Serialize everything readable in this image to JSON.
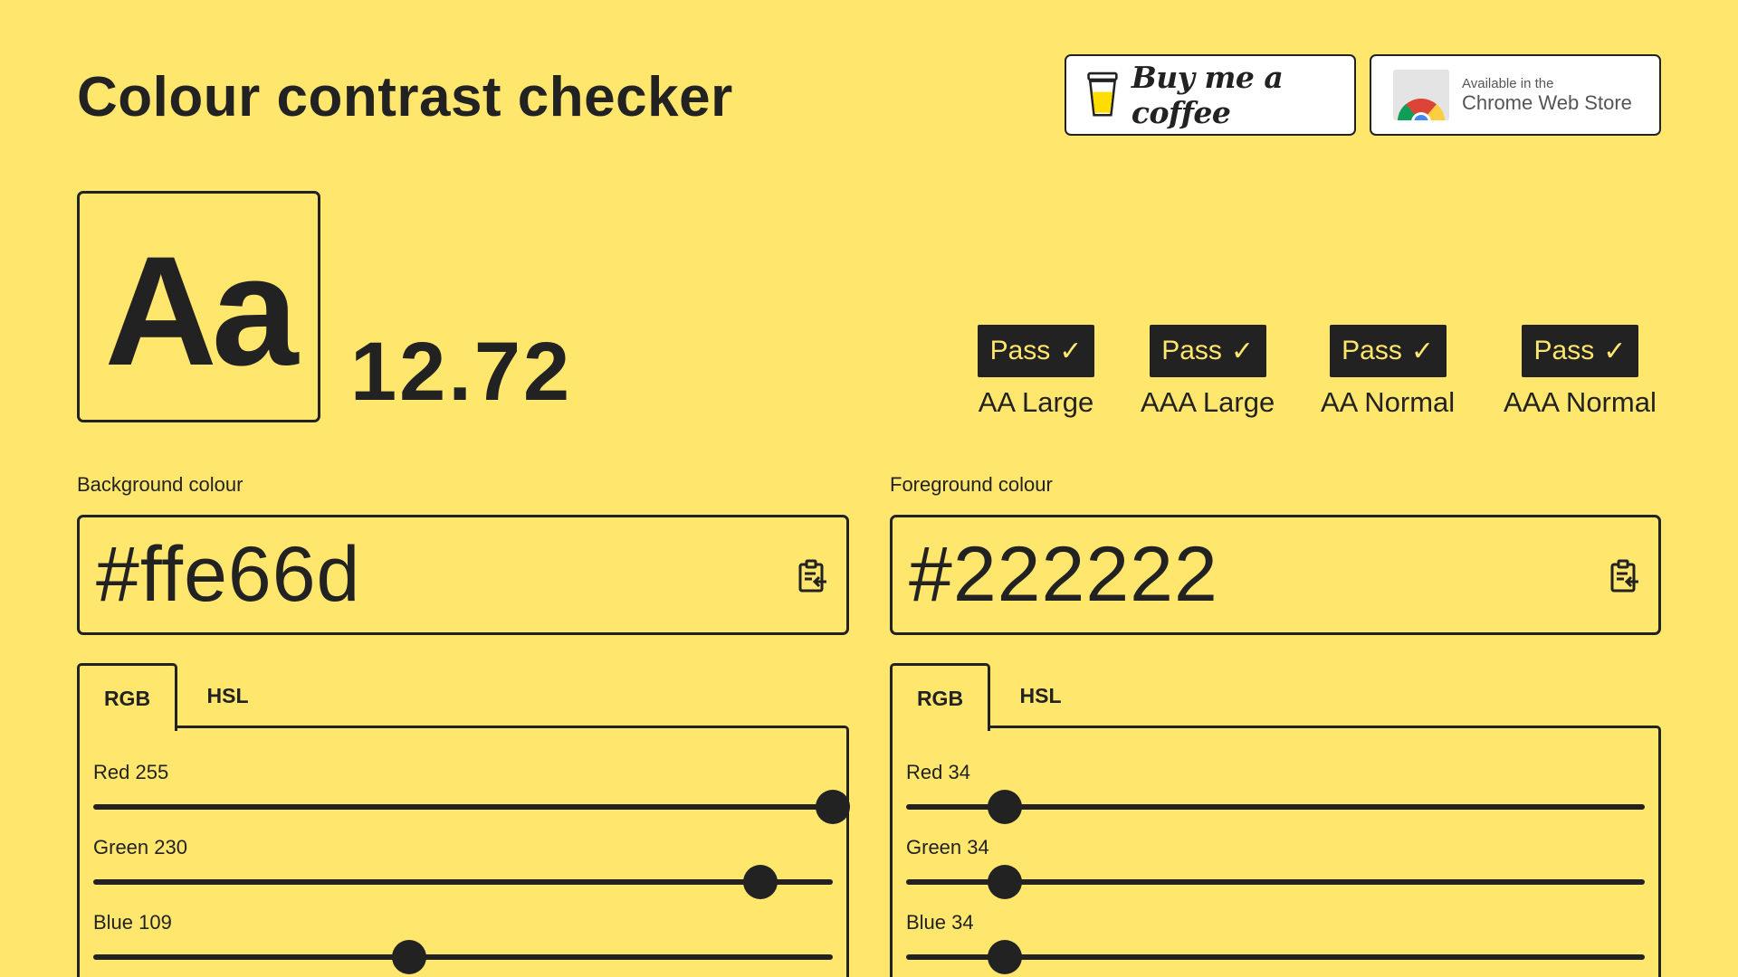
{
  "title": "Colour contrast checker",
  "buy_coffee": {
    "label": "Buy me a coffee",
    "icon": "coffee-cup-icon"
  },
  "chrome_store": {
    "small": "Available in the",
    "big": "Chrome Web Store",
    "icon": "chrome-logo-icon"
  },
  "preview": {
    "text": "Aa"
  },
  "ratio": "12.72",
  "results": [
    {
      "badge": "Pass",
      "label": "AA Large"
    },
    {
      "badge": "Pass",
      "label": "AAA Large"
    },
    {
      "badge": "Pass",
      "label": "AA Normal"
    },
    {
      "badge": "Pass",
      "label": "AAA Normal"
    }
  ],
  "background": {
    "label": "Background colour",
    "hex": "#ffe66d",
    "tabs": [
      "RGB",
      "HSL"
    ],
    "active_tab": "RGB",
    "sliders": [
      {
        "label": "Red 255",
        "value": 255,
        "max": 255
      },
      {
        "label": "Green 230",
        "value": 230,
        "max": 255
      },
      {
        "label": "Blue 109",
        "value": 109,
        "max": 255
      }
    ]
  },
  "foreground": {
    "label": "Foreground colour",
    "hex": "#222222",
    "tabs": [
      "RGB",
      "HSL"
    ],
    "active_tab": "RGB",
    "sliders": [
      {
        "label": "Red 34",
        "value": 34,
        "max": 255
      },
      {
        "label": "Green 34",
        "value": 34,
        "max": 255
      },
      {
        "label": "Blue 34",
        "value": 34,
        "max": 255
      }
    ]
  },
  "colors": {
    "page_bg": "#ffe66d",
    "ink": "#222222"
  }
}
